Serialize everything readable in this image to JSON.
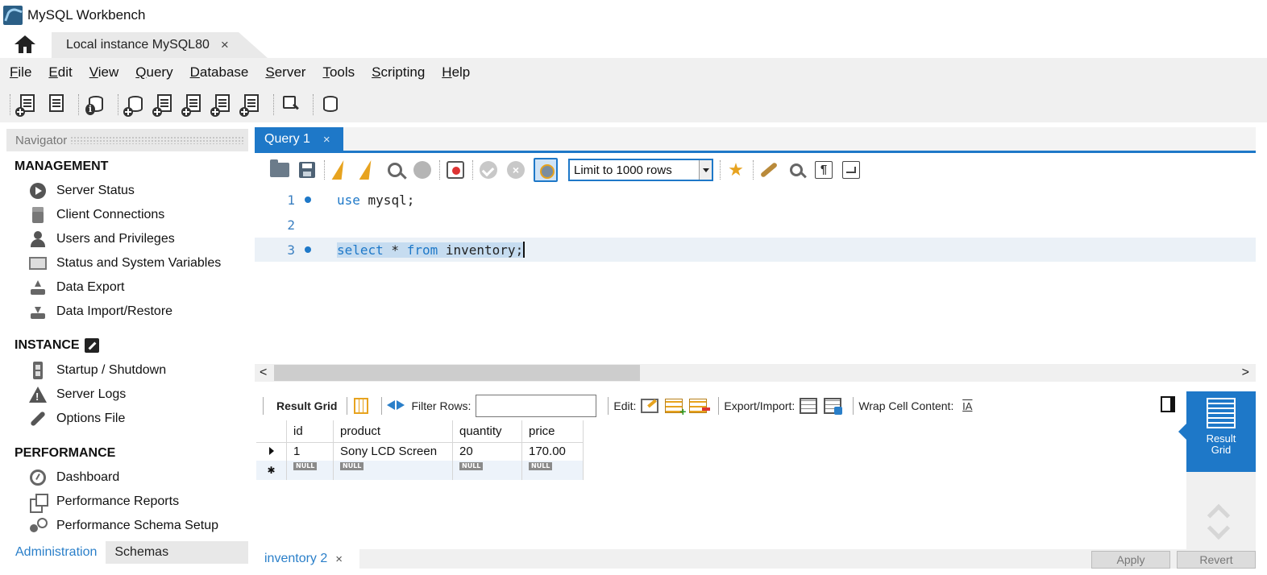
{
  "window": {
    "title": "MySQL Workbench"
  },
  "tabs": {
    "connection_label": "Local instance MySQL80",
    "close_glyph": "×"
  },
  "menu": [
    {
      "pre": "",
      "ul": "F",
      "post": "ile"
    },
    {
      "pre": "",
      "ul": "E",
      "post": "dit"
    },
    {
      "pre": "",
      "ul": "V",
      "post": "iew"
    },
    {
      "pre": "",
      "ul": "Q",
      "post": "uery"
    },
    {
      "pre": "",
      "ul": "D",
      "post": "atabase"
    },
    {
      "pre": "",
      "ul": "S",
      "post": "erver"
    },
    {
      "pre": "",
      "ul": "T",
      "post": "ools"
    },
    {
      "pre": "",
      "ul": "S",
      "post": "cripting"
    },
    {
      "pre": "",
      "ul": "H",
      "post": "elp"
    }
  ],
  "navigator": {
    "header": "Navigator",
    "management": {
      "title": "MANAGEMENT",
      "items": [
        "Server Status",
        "Client Connections",
        "Users and Privileges",
        "Status and System Variables",
        "Data Export",
        "Data Import/Restore"
      ]
    },
    "instance": {
      "title": "INSTANCE",
      "items": [
        "Startup / Shutdown",
        "Server Logs",
        "Options File"
      ]
    },
    "performance": {
      "title": "PERFORMANCE",
      "items": [
        "Dashboard",
        "Performance Reports",
        "Performance Schema Setup"
      ]
    },
    "bottom_tabs": [
      "Administration",
      "Schemas"
    ]
  },
  "query": {
    "tab_label": "Query 1",
    "limit_label": "Limit to 1000 rows",
    "lines": [
      {
        "num": "1",
        "kw1": "use",
        "rest": " mysql;"
      },
      {
        "num": "2"
      },
      {
        "num": "3",
        "kw1": "select",
        "mid": " * ",
        "kw2": "from",
        "rest": " inventory;"
      }
    ]
  },
  "result_toolbar": {
    "result_grid": "Result Grid",
    "filter_rows": "Filter Rows:",
    "edit": "Edit:",
    "export_import": "Export/Import:",
    "wrap_cell": "Wrap Cell Content:",
    "wrap_icon": "IA"
  },
  "result_grid": {
    "columns": [
      "id",
      "product",
      "quantity",
      "price"
    ],
    "row": [
      "1",
      "Sony LCD Screen",
      "20",
      "170.00"
    ],
    "null_label": "NULL"
  },
  "right_panel": {
    "result_grid_label": "Result\nGrid",
    "line1": "Result",
    "line2": "Grid"
  },
  "bottom": {
    "result_tab": "inventory 2",
    "apply": "Apply",
    "revert": "Revert"
  },
  "colors": {
    "accent": "#1e78c8",
    "keyword": "#1e78c8",
    "selection": "#c6dcf0"
  }
}
